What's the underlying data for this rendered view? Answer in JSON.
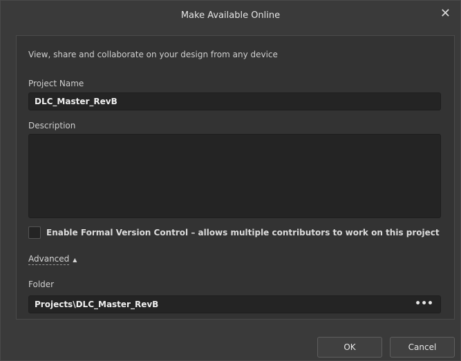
{
  "window": {
    "title": "Make Available Online",
    "close": "✕"
  },
  "intro": "View, share and collaborate on your design from any device",
  "project_name": {
    "label": "Project Name",
    "value": "DLC_Master_RevB"
  },
  "description": {
    "label": "Description",
    "value": ""
  },
  "formal_version_control": {
    "label": "Enable Formal Version Control – allows multiple contributors to work on this project",
    "checked": false
  },
  "advanced": {
    "label": "Advanced",
    "caret": "▲"
  },
  "folder": {
    "label": "Folder",
    "value": "Projects\\DLC_Master_RevB",
    "browse": "•••"
  },
  "buttons": {
    "ok": "OK",
    "cancel": "Cancel"
  }
}
